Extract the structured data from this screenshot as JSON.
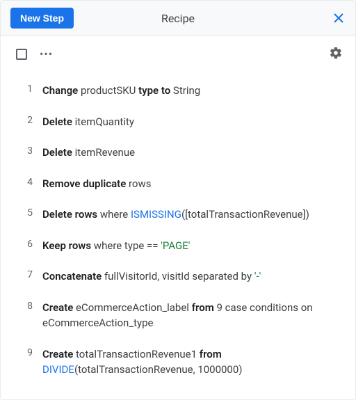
{
  "header": {
    "button": "New Step",
    "title": "Recipe"
  },
  "steps": [
    {
      "n": "1",
      "parts": [
        {
          "t": "Change ",
          "c": "bold"
        },
        {
          "t": "productSKU ",
          "c": "col"
        },
        {
          "t": "type to ",
          "c": "bold"
        },
        {
          "t": "String",
          "c": "col"
        }
      ]
    },
    {
      "n": "2",
      "parts": [
        {
          "t": "Delete ",
          "c": "bold"
        },
        {
          "t": "itemQuantity",
          "c": "col"
        }
      ]
    },
    {
      "n": "3",
      "parts": [
        {
          "t": "Delete ",
          "c": "bold"
        },
        {
          "t": "itemRevenue",
          "c": "col"
        }
      ]
    },
    {
      "n": "4",
      "parts": [
        {
          "t": "Remove duplicate ",
          "c": "bold"
        },
        {
          "t": "rows",
          "c": "col"
        }
      ]
    },
    {
      "n": "5",
      "parts": [
        {
          "t": "Delete rows ",
          "c": "bold"
        },
        {
          "t": "where ",
          "c": "col"
        },
        {
          "t": "ISMISSING",
          "c": "func"
        },
        {
          "t": "([totalTransactionRevenue])",
          "c": "col"
        }
      ]
    },
    {
      "n": "6",
      "parts": [
        {
          "t": "Keep rows ",
          "c": "bold"
        },
        {
          "t": "where type == ",
          "c": "col"
        },
        {
          "t": "'PAGE'",
          "c": "str"
        }
      ]
    },
    {
      "n": "7",
      "parts": [
        {
          "t": "Concatenate ",
          "c": "bold"
        },
        {
          "t": "fullVisitorId, visitId separated by ",
          "c": "col"
        },
        {
          "t": "'-'",
          "c": "str"
        }
      ]
    },
    {
      "n": "8",
      "parts": [
        {
          "t": "Create ",
          "c": "bold"
        },
        {
          "t": "eCommerceAction_label ",
          "c": "col"
        },
        {
          "t": "from ",
          "c": "bold"
        },
        {
          "t": "9 case conditions on eCommerceAction_type",
          "c": "col"
        }
      ]
    },
    {
      "n": "9",
      "parts": [
        {
          "t": "Create ",
          "c": "bold"
        },
        {
          "t": "totalTransactionRevenue1 ",
          "c": "col"
        },
        {
          "t": "from ",
          "c": "bold"
        },
        {
          "t": "DIVIDE",
          "c": "func"
        },
        {
          "t": "(totalTransactionRevenue, 1000000)",
          "c": "col"
        }
      ]
    }
  ]
}
